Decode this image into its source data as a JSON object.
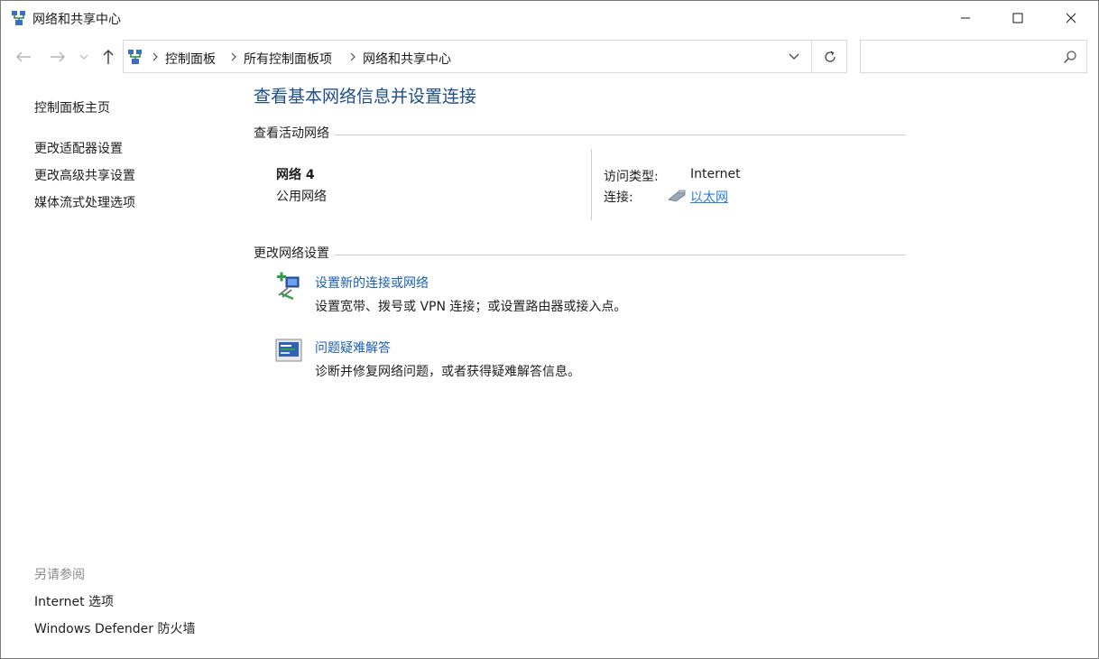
{
  "window": {
    "title": "网络和共享中心",
    "icon": "network-icon"
  },
  "address_bar": {
    "breadcrumbs": [
      "控制面板",
      "所有控制面板项",
      "网络和共享中心"
    ],
    "search_placeholder": ""
  },
  "sidebar": {
    "items": [
      {
        "label": "控制面板主页"
      },
      {
        "label": "更改适配器设置"
      },
      {
        "label": "更改高级共享设置"
      },
      {
        "label": "媒体流式处理选项"
      }
    ],
    "see_also_heading": "另请参阅",
    "see_also": [
      {
        "label": "Internet 选项"
      },
      {
        "label": "Windows Defender 防火墙"
      }
    ]
  },
  "main": {
    "title": "查看基本网络信息并设置连接",
    "active_networks_heading": "查看活动网络",
    "network": {
      "name": "网络 4",
      "type": "公用网络",
      "access_type_label": "访问类型:",
      "access_type_value": "Internet",
      "connection_label": "连接:",
      "connection_value": "以太网"
    },
    "change_settings_heading": "更改网络设置",
    "tasks": [
      {
        "title": "设置新的连接或网络",
        "description": "设置宽带、拨号或 VPN 连接；或设置路由器或接入点。",
        "icon": "new-connection-icon"
      },
      {
        "title": "问题疑难解答",
        "description": "诊断并修复网络问题，或者获得疑难解答信息。",
        "icon": "troubleshoot-icon"
      }
    ]
  },
  "colors": {
    "title_blue": "#1e4e8c",
    "link_blue": "#1a5fb4",
    "hyperlink_blue": "#2a7de1",
    "muted_gray": "#8a8a8a"
  }
}
